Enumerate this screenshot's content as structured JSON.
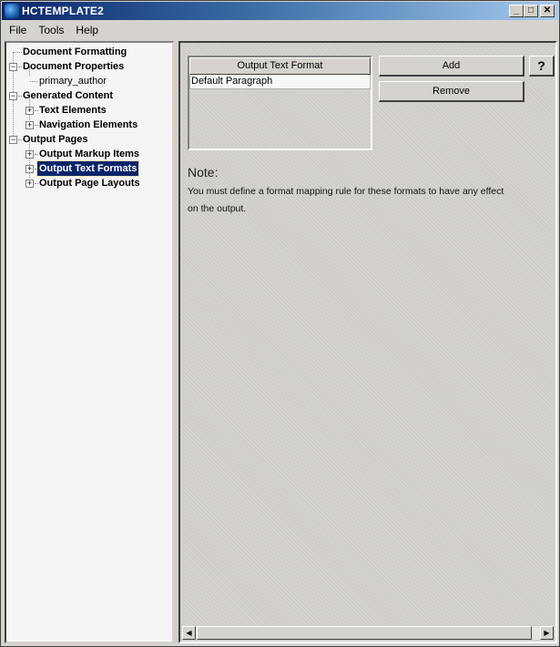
{
  "window": {
    "title": "HCTEMPLATE2",
    "icon": "app-globe-icon",
    "controls": {
      "minimize": "_",
      "maximize": "□",
      "close": "✕"
    }
  },
  "menubar": {
    "items": [
      {
        "label": "File"
      },
      {
        "label": "Tools"
      },
      {
        "label": "Help"
      }
    ]
  },
  "tree": {
    "items": [
      {
        "label": "Document Formatting",
        "level": 0,
        "expander": null,
        "bold": true
      },
      {
        "label": "Document Properties",
        "level": 0,
        "expander": "−",
        "bold": true
      },
      {
        "label": "primary_author",
        "level": 1,
        "expander": null,
        "bold": false
      },
      {
        "label": "Generated Content",
        "level": 0,
        "expander": "−",
        "bold": true
      },
      {
        "label": "Text Elements",
        "level": 1,
        "expander": "+",
        "bold": true
      },
      {
        "label": "Navigation Elements",
        "level": 1,
        "expander": "+",
        "bold": true
      },
      {
        "label": "Output Pages",
        "level": 0,
        "expander": "−",
        "bold": true
      },
      {
        "label": "Output Markup Items",
        "level": 1,
        "expander": "+",
        "bold": true
      },
      {
        "label": "Output Text Formats",
        "level": 1,
        "expander": "+",
        "bold": true,
        "selected": true
      },
      {
        "label": "Output Page Layouts",
        "level": 1,
        "expander": "+",
        "bold": true
      }
    ]
  },
  "content": {
    "list": {
      "header": "Output Text Format",
      "rows": [
        "Default Paragraph"
      ]
    },
    "buttons": {
      "add": "Add",
      "remove": "Remove",
      "help": "?"
    },
    "note": {
      "title": "Note:",
      "text": "You must define a format mapping rule for these formats to have any effect on the output."
    },
    "scrollbar": {
      "left_arrow": "◀",
      "right_arrow": "▶"
    }
  }
}
